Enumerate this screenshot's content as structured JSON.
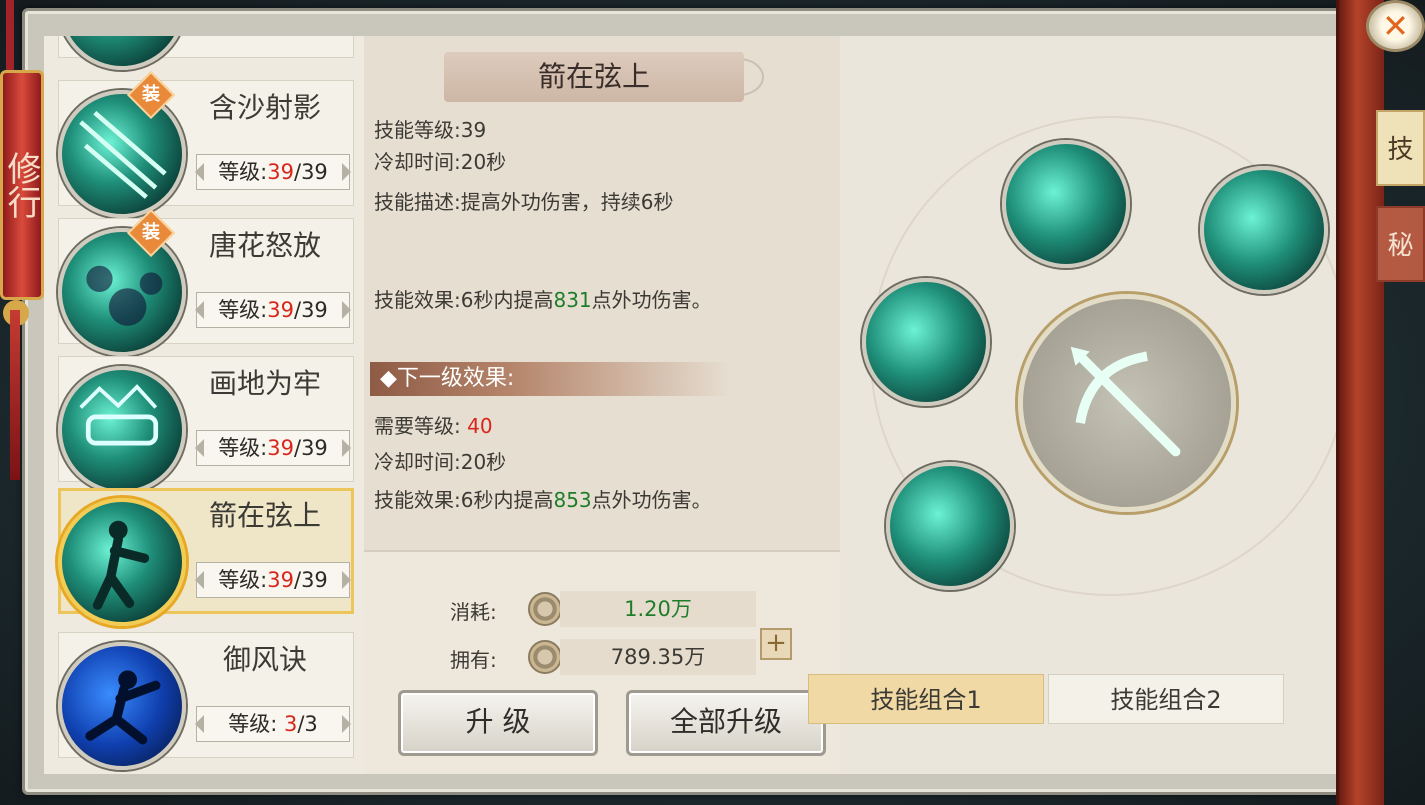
{
  "lantern": {
    "text": "修行"
  },
  "skills": [
    {
      "name": "含沙射影",
      "equipped": true,
      "equip_badge": "装",
      "level_label": "等级:",
      "level_cur": "39",
      "level_max": "/39",
      "selected": false
    },
    {
      "name": "唐花怒放",
      "equipped": true,
      "equip_badge": "装",
      "level_label": "等级:",
      "level_cur": "39",
      "level_max": "/39",
      "selected": false
    },
    {
      "name": "画地为牢",
      "equipped": false,
      "equip_badge": "",
      "level_label": "等级:",
      "level_cur": "39",
      "level_max": "/39",
      "selected": false
    },
    {
      "name": "箭在弦上",
      "equipped": false,
      "equip_badge": "",
      "level_label": "等级:",
      "level_cur": "39",
      "level_max": "/39",
      "selected": true
    },
    {
      "name": "御风诀",
      "equipped": false,
      "equip_badge": "",
      "level_label": "等级: ",
      "level_cur": "3",
      "level_max": "/3",
      "selected": false
    }
  ],
  "info": {
    "title": "箭在弦上",
    "skill_level": "技能等级:39",
    "cooldown": "冷却时间:20秒",
    "description": "技能描述:提高外功伤害，持续6秒",
    "effect_prefix": "技能效果:6秒内提高",
    "effect_value": "831",
    "effect_suffix": "点外功伤害。",
    "next_header": "下一级效果:",
    "req_level_label": "需要等级: ",
    "req_level_value": "40",
    "next_cooldown": "冷却时间:20秒",
    "next_effect_prefix": "技能效果:6秒内提高",
    "next_effect_value": "853",
    "next_effect_suffix": "点外功伤害。"
  },
  "cost": {
    "consume_label": "消耗:",
    "consume_value": "1.20万",
    "own_label": "拥有:",
    "own_value": "789.35万",
    "plus": "+"
  },
  "buttons": {
    "upgrade": "升 级",
    "upgrade_all": "全部升级"
  },
  "combo": {
    "tab1": "技能组合1",
    "tab2": "技能组合2"
  },
  "side_tabs": {
    "tab1": "技",
    "tab2": "秘"
  },
  "close_glyph": "✕"
}
